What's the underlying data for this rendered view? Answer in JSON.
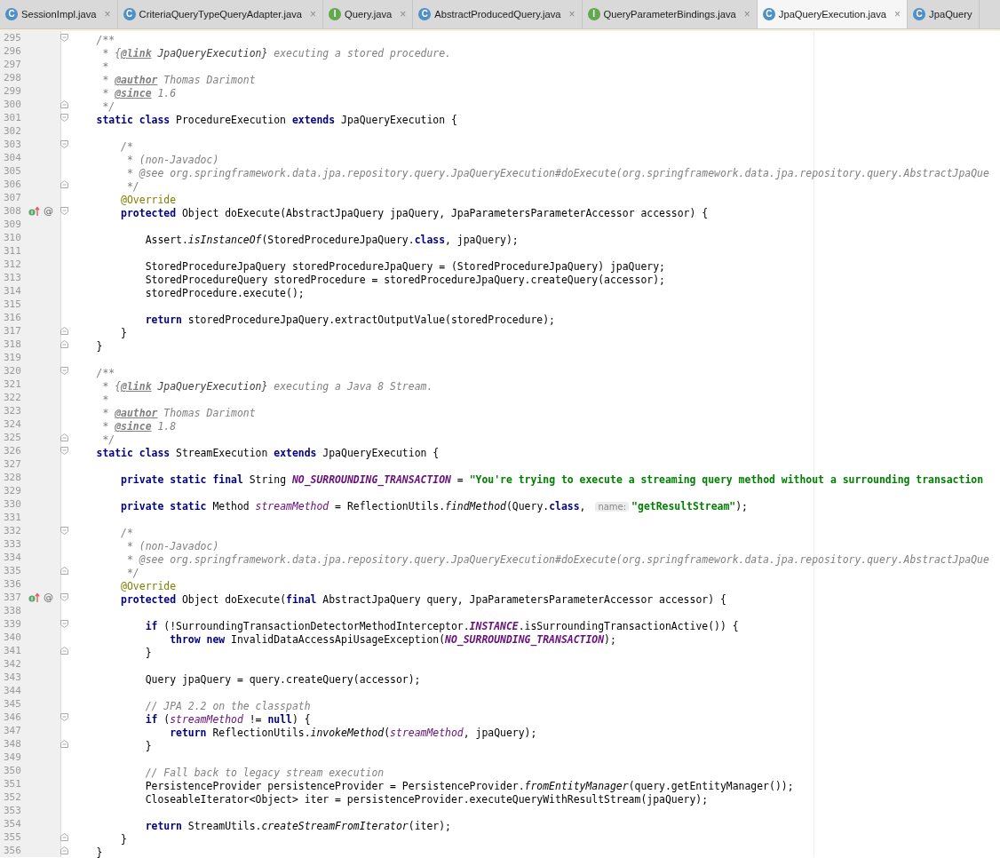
{
  "tabs": [
    {
      "label": "SessionImpl.java",
      "kind": "class",
      "icon_letter": "C",
      "selected": false,
      "close": "×"
    },
    {
      "label": "CriteriaQueryTypeQueryAdapter.java",
      "kind": "class",
      "icon_letter": "C",
      "selected": false,
      "close": "×"
    },
    {
      "label": "Query.java",
      "kind": "interface",
      "icon_letter": "I",
      "selected": false,
      "close": "×"
    },
    {
      "label": "AbstractProducedQuery.java",
      "kind": "class",
      "icon_letter": "C",
      "selected": false,
      "close": "×"
    },
    {
      "label": "QueryParameterBindings.java",
      "kind": "interface",
      "icon_letter": "I",
      "selected": false,
      "close": "×"
    },
    {
      "label": "JpaQueryExecution.java",
      "kind": "class",
      "icon_letter": "C",
      "selected": true,
      "close": "×"
    },
    {
      "label": "JpaQuery",
      "kind": "class",
      "icon_letter": "C",
      "selected": false
    }
  ],
  "lines": [
    {
      "number": "295",
      "fold_marker": {
        "kind": "start"
      },
      "tokens": [
        {
          "kind": "doc",
          "text": "    /**"
        }
      ]
    },
    {
      "number": "296",
      "tokens": [
        {
          "kind": "doc",
          "text": "     * {"
        },
        {
          "kind": "doctag",
          "text": "@link"
        },
        {
          "kind": "docref",
          "text": " JpaQueryExecution}"
        },
        {
          "kind": "doc",
          "text": " executing a stored procedure."
        }
      ]
    },
    {
      "number": "297",
      "tokens": [
        {
          "kind": "doc",
          "text": "     *"
        }
      ]
    },
    {
      "number": "298",
      "tokens": [
        {
          "kind": "doc",
          "text": "     * "
        },
        {
          "kind": "doctag",
          "text": "@author"
        },
        {
          "kind": "doc",
          "text": " Thomas Darimont"
        }
      ]
    },
    {
      "number": "299",
      "tokens": [
        {
          "kind": "doc",
          "text": "     * "
        },
        {
          "kind": "doctag",
          "text": "@since"
        },
        {
          "kind": "doc",
          "text": " 1.6"
        }
      ]
    },
    {
      "number": "300",
      "fold_marker": {
        "kind": "end"
      },
      "tokens": [
        {
          "kind": "doc",
          "text": "     */"
        }
      ]
    },
    {
      "number": "301",
      "fold_marker": {
        "kind": "start"
      },
      "tokens": [
        {
          "kind": "keyword",
          "text": "    static class "
        },
        {
          "kind": "plain",
          "text": "ProcedureExecution "
        },
        {
          "kind": "keyword",
          "text": "extends "
        },
        {
          "kind": "plain",
          "text": "JpaQueryExecution {"
        }
      ]
    },
    {
      "number": "302"
    },
    {
      "number": "303",
      "fold_marker": {
        "kind": "start"
      },
      "tokens": [
        {
          "kind": "comment",
          "text": "        /*"
        }
      ]
    },
    {
      "number": "304",
      "tokens": [
        {
          "kind": "comment",
          "text": "         * (non-Javadoc)"
        }
      ]
    },
    {
      "number": "305",
      "tokens": [
        {
          "kind": "comment",
          "text": "         * @see org.springframework.data.jpa.repository.query.JpaQueryExecution#doExecute(org.springframework.data.jpa.repository.query.AbstractJpaQue"
        }
      ]
    },
    {
      "number": "306",
      "fold_marker": {
        "kind": "end"
      },
      "tokens": [
        {
          "kind": "comment",
          "text": "         */"
        }
      ]
    },
    {
      "number": "307",
      "tokens": [
        {
          "kind": "annotation",
          "text": "        @Override"
        }
      ]
    },
    {
      "number": "308",
      "fold_marker": {
        "kind": "start"
      },
      "gutter_icons": [
        {
          "kind": "overrides"
        },
        {
          "kind": "symbol",
          "text": "@"
        }
      ],
      "tokens": [
        {
          "kind": "keyword",
          "text": "        protected "
        },
        {
          "kind": "plain",
          "text": "Object doExecute(AbstractJpaQuery jpaQuery, JpaParametersParameterAccessor accessor) {"
        }
      ]
    },
    {
      "number": "309"
    },
    {
      "number": "310",
      "tokens": [
        {
          "kind": "plain",
          "text": "            Assert."
        },
        {
          "kind": "italic",
          "text": "isInstanceOf"
        },
        {
          "kind": "plain",
          "text": "(StoredProcedureJpaQuery."
        },
        {
          "kind": "keyword",
          "text": "class"
        },
        {
          "kind": "plain",
          "text": ", jpaQuery);"
        }
      ]
    },
    {
      "number": "311"
    },
    {
      "number": "312",
      "tokens": [
        {
          "kind": "plain",
          "text": "            StoredProcedureJpaQuery storedProcedureJpaQuery = (StoredProcedureJpaQuery) jpaQuery;"
        }
      ]
    },
    {
      "number": "313",
      "tokens": [
        {
          "kind": "plain",
          "text": "            StoredProcedureQuery storedProcedure = storedProcedureJpaQuery.createQuery(accessor);"
        }
      ]
    },
    {
      "number": "314",
      "tokens": [
        {
          "kind": "plain",
          "text": "            storedProcedure.execute();"
        }
      ]
    },
    {
      "number": "315"
    },
    {
      "number": "316",
      "tokens": [
        {
          "kind": "keyword",
          "text": "            return "
        },
        {
          "kind": "plain",
          "text": "storedProcedureJpaQuery.extractOutputValue(storedProcedure);"
        }
      ]
    },
    {
      "number": "317",
      "fold_marker": {
        "kind": "end"
      },
      "tokens": [
        {
          "kind": "plain",
          "text": "        }"
        }
      ]
    },
    {
      "number": "318",
      "fold_marker": {
        "kind": "end"
      },
      "tokens": [
        {
          "kind": "plain",
          "text": "    }"
        }
      ]
    },
    {
      "number": "319"
    },
    {
      "number": "320",
      "fold_marker": {
        "kind": "start"
      },
      "tokens": [
        {
          "kind": "doc",
          "text": "    /**"
        }
      ]
    },
    {
      "number": "321",
      "tokens": [
        {
          "kind": "doc",
          "text": "     * {"
        },
        {
          "kind": "doctag",
          "text": "@link"
        },
        {
          "kind": "docref",
          "text": " JpaQueryExecution}"
        },
        {
          "kind": "doc",
          "text": " executing a Java 8 Stream."
        }
      ]
    },
    {
      "number": "322",
      "tokens": [
        {
          "kind": "doc",
          "text": "     *"
        }
      ]
    },
    {
      "number": "323",
      "tokens": [
        {
          "kind": "doc",
          "text": "     * "
        },
        {
          "kind": "doctag",
          "text": "@author"
        },
        {
          "kind": "doc",
          "text": " Thomas Darimont"
        }
      ]
    },
    {
      "number": "324",
      "tokens": [
        {
          "kind": "doc",
          "text": "     * "
        },
        {
          "kind": "doctag",
          "text": "@since"
        },
        {
          "kind": "doc",
          "text": " 1.8"
        }
      ]
    },
    {
      "number": "325",
      "fold_marker": {
        "kind": "end"
      },
      "tokens": [
        {
          "kind": "doc",
          "text": "     */"
        }
      ]
    },
    {
      "number": "326",
      "fold_marker": {
        "kind": "start"
      },
      "tokens": [
        {
          "kind": "keyword",
          "text": "    static class "
        },
        {
          "kind": "plain",
          "text": "StreamExecution "
        },
        {
          "kind": "keyword",
          "text": "extends "
        },
        {
          "kind": "plain",
          "text": "JpaQueryExecution {"
        }
      ]
    },
    {
      "number": "327"
    },
    {
      "number": "328",
      "tokens": [
        {
          "kind": "keyword",
          "text": "        private static final "
        },
        {
          "kind": "plain",
          "text": "String "
        },
        {
          "kind": "constant",
          "text": "NO_SURROUNDING_TRANSACTION"
        },
        {
          "kind": "plain",
          "text": " = "
        },
        {
          "kind": "string",
          "text": "\"You're trying to execute a streaming query method without a surrounding transaction"
        }
      ]
    },
    {
      "number": "329"
    },
    {
      "number": "330",
      "tokens": [
        {
          "kind": "keyword",
          "text": "        private static "
        },
        {
          "kind": "plain",
          "text": "Method "
        },
        {
          "kind": "field",
          "text": "streamMethod"
        },
        {
          "kind": "plain",
          "text": " = ReflectionUtils."
        },
        {
          "kind": "italic",
          "text": "findMethod"
        },
        {
          "kind": "plain",
          "text": "(Query."
        },
        {
          "kind": "keyword",
          "text": "class"
        },
        {
          "kind": "plain",
          "text": ", "
        },
        {
          "kind": "hint",
          "text": "name:"
        },
        {
          "kind": "string",
          "text": "\"getResultStream\""
        },
        {
          "kind": "plain",
          "text": ");"
        }
      ]
    },
    {
      "number": "331"
    },
    {
      "number": "332",
      "fold_marker": {
        "kind": "start"
      },
      "tokens": [
        {
          "kind": "comment",
          "text": "        /*"
        }
      ]
    },
    {
      "number": "333",
      "tokens": [
        {
          "kind": "comment",
          "text": "         * (non-Javadoc)"
        }
      ]
    },
    {
      "number": "334",
      "tokens": [
        {
          "kind": "comment",
          "text": "         * @see org.springframework.data.jpa.repository.query.JpaQueryExecution#doExecute(org.springframework.data.jpa.repository.query.AbstractJpaQue"
        }
      ]
    },
    {
      "number": "335",
      "fold_marker": {
        "kind": "end"
      },
      "tokens": [
        {
          "kind": "comment",
          "text": "         */"
        }
      ]
    },
    {
      "number": "336",
      "tokens": [
        {
          "kind": "annotation",
          "text": "        @Override"
        }
      ]
    },
    {
      "number": "337",
      "fold_marker": {
        "kind": "start"
      },
      "gutter_icons": [
        {
          "kind": "overrides"
        },
        {
          "kind": "symbol",
          "text": "@"
        }
      ],
      "tokens": [
        {
          "kind": "keyword",
          "text": "        protected "
        },
        {
          "kind": "plain",
          "text": "Object doExecute("
        },
        {
          "kind": "keyword",
          "text": "final "
        },
        {
          "kind": "plain",
          "text": "AbstractJpaQuery query, JpaParametersParameterAccessor accessor) {"
        }
      ]
    },
    {
      "number": "338"
    },
    {
      "number": "339",
      "fold_marker": {
        "kind": "start"
      },
      "tokens": [
        {
          "kind": "keyword",
          "text": "            if "
        },
        {
          "kind": "plain",
          "text": "(!SurroundingTransactionDetectorMethodInterceptor."
        },
        {
          "kind": "constant",
          "text": "INSTANCE"
        },
        {
          "kind": "plain",
          "text": ".isSurroundingTransactionActive()) {"
        }
      ]
    },
    {
      "number": "340",
      "tokens": [
        {
          "kind": "keyword",
          "text": "                throw new "
        },
        {
          "kind": "plain",
          "text": "InvalidDataAccessApiUsageException("
        },
        {
          "kind": "constant",
          "text": "NO_SURROUNDING_TRANSACTION"
        },
        {
          "kind": "plain",
          "text": ");"
        }
      ]
    },
    {
      "number": "341",
      "fold_marker": {
        "kind": "end"
      },
      "tokens": [
        {
          "kind": "plain",
          "text": "            }"
        }
      ]
    },
    {
      "number": "342"
    },
    {
      "number": "343",
      "tokens": [
        {
          "kind": "plain",
          "text": "            Query jpaQuery = query.createQuery(accessor);"
        }
      ]
    },
    {
      "number": "344"
    },
    {
      "number": "345",
      "tokens": [
        {
          "kind": "comment",
          "text": "            // JPA 2.2 on the classpath"
        }
      ]
    },
    {
      "number": "346",
      "fold_marker": {
        "kind": "start"
      },
      "tokens": [
        {
          "kind": "keyword",
          "text": "            if "
        },
        {
          "kind": "plain",
          "text": "("
        },
        {
          "kind": "field",
          "text": "streamMethod"
        },
        {
          "kind": "plain",
          "text": " != "
        },
        {
          "kind": "keyword",
          "text": "null"
        },
        {
          "kind": "plain",
          "text": ") {"
        }
      ]
    },
    {
      "number": "347",
      "tokens": [
        {
          "kind": "keyword",
          "text": "                return "
        },
        {
          "kind": "plain",
          "text": "ReflectionUtils."
        },
        {
          "kind": "italic",
          "text": "invokeMethod"
        },
        {
          "kind": "plain",
          "text": "("
        },
        {
          "kind": "field",
          "text": "streamMethod"
        },
        {
          "kind": "plain",
          "text": ", jpaQuery);"
        }
      ]
    },
    {
      "number": "348",
      "fold_marker": {
        "kind": "end"
      },
      "tokens": [
        {
          "kind": "plain",
          "text": "            }"
        }
      ]
    },
    {
      "number": "349"
    },
    {
      "number": "350",
      "tokens": [
        {
          "kind": "comment",
          "text": "            // Fall back to legacy stream execution"
        }
      ]
    },
    {
      "number": "351",
      "tokens": [
        {
          "kind": "plain",
          "text": "            PersistenceProvider persistenceProvider = PersistenceProvider."
        },
        {
          "kind": "italic",
          "text": "fromEntityManager"
        },
        {
          "kind": "plain",
          "text": "(query.getEntityManager());"
        }
      ]
    },
    {
      "number": "352",
      "tokens": [
        {
          "kind": "plain",
          "text": "            CloseableIterator<Object> iter = persistenceProvider.executeQueryWithResultStream(jpaQuery);"
        }
      ]
    },
    {
      "number": "353"
    },
    {
      "number": "354",
      "tokens": [
        {
          "kind": "keyword",
          "text": "            return "
        },
        {
          "kind": "plain",
          "text": "StreamUtils."
        },
        {
          "kind": "italic",
          "text": "createStreamFromIterator"
        },
        {
          "kind": "plain",
          "text": "(iter);"
        }
      ]
    },
    {
      "number": "355",
      "fold_marker": {
        "kind": "end"
      },
      "tokens": [
        {
          "kind": "plain",
          "text": "        }"
        }
      ]
    },
    {
      "number": "356",
      "fold_marker": {
        "kind": "end"
      },
      "tokens": [
        {
          "kind": "plain",
          "text": "    }"
        }
      ]
    }
  ]
}
